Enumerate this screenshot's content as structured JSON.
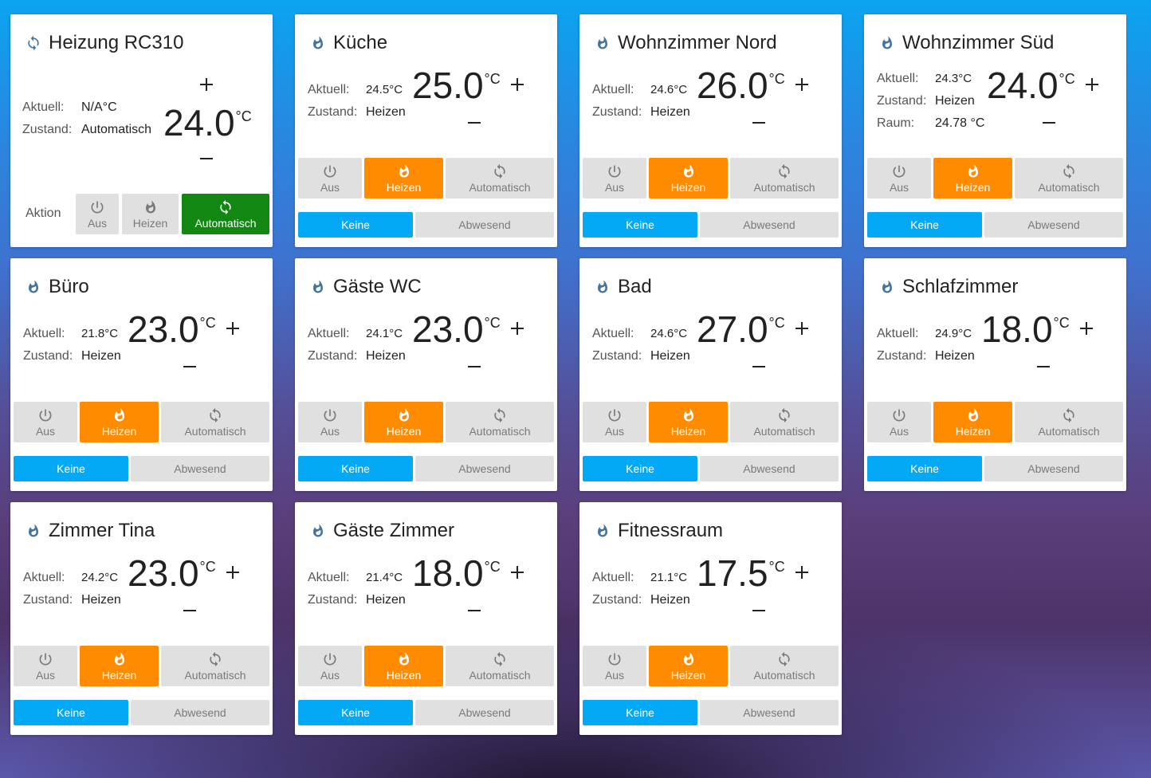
{
  "colors": {
    "flame_blue": "#44739e",
    "heat_orange": "#ff8c00",
    "auto_green": "#128812",
    "preset_blue": "#03a9f4",
    "button_grey": "#e0e0e0"
  },
  "labels": {
    "current": "Aktuell:",
    "state": "Zustand:",
    "room": "Raum:",
    "action": "Aktion",
    "unit": "°C",
    "plus": "+",
    "minus": "–",
    "mode_off": "Aus",
    "mode_heat": "Heizen",
    "mode_auto": "Automatisch",
    "preset_none": "Keine",
    "preset_away": "Abwesend"
  },
  "main": {
    "title": "Heizung RC310",
    "icon": "refresh-icon",
    "current": "N/A°C",
    "state": "Automatisch",
    "target": "24.0",
    "active_mode": "auto"
  },
  "cards": [
    {
      "title": "Küche",
      "current": "24.5°C",
      "state": "Heizen",
      "target": "25.0",
      "icon": "flame-icon",
      "active_mode": "heat",
      "active_preset": "none"
    },
    {
      "title": "Wohnzimmer Nord",
      "current": "24.6°C",
      "state": "Heizen",
      "target": "26.0",
      "icon": "flame-icon",
      "active_mode": "heat",
      "active_preset": "none"
    },
    {
      "title": "Wohnzimmer Süd",
      "current": "24.3°C",
      "state": "Heizen",
      "room": "24.78 °C",
      "target": "24.0",
      "icon": "flame-icon",
      "active_mode": "heat",
      "active_preset": "none"
    },
    {
      "title": "Büro",
      "current": "21.8°C",
      "state": "Heizen",
      "target": "23.0",
      "icon": "flame-icon",
      "active_mode": "heat",
      "active_preset": "none"
    },
    {
      "title": "Gäste WC",
      "current": "24.1°C",
      "state": "Heizen",
      "target": "23.0",
      "icon": "flame-icon",
      "active_mode": "heat",
      "active_preset": "none"
    },
    {
      "title": "Bad",
      "current": "24.6°C",
      "state": "Heizen",
      "target": "27.0",
      "icon": "flame-icon",
      "active_mode": "heat",
      "active_preset": "none"
    },
    {
      "title": "Schlafzimmer",
      "current": "24.9°C",
      "state": "Heizen",
      "target": "18.0",
      "icon": "flame-icon",
      "active_mode": "heat",
      "active_preset": "none"
    },
    {
      "title": "Zimmer Tina",
      "current": "24.2°C",
      "state": "Heizen",
      "target": "23.0",
      "icon": "flame-icon",
      "active_mode": "heat",
      "active_preset": "none"
    },
    {
      "title": "Gäste Zimmer",
      "current": "21.4°C",
      "state": "Heizen",
      "target": "18.0",
      "icon": "flame-icon",
      "active_mode": "heat",
      "active_preset": "none"
    },
    {
      "title": "Fitnessraum",
      "current": "21.1°C",
      "state": "Heizen",
      "target": "17.5",
      "icon": "flame-icon",
      "active_mode": "heat",
      "active_preset": "none"
    }
  ]
}
